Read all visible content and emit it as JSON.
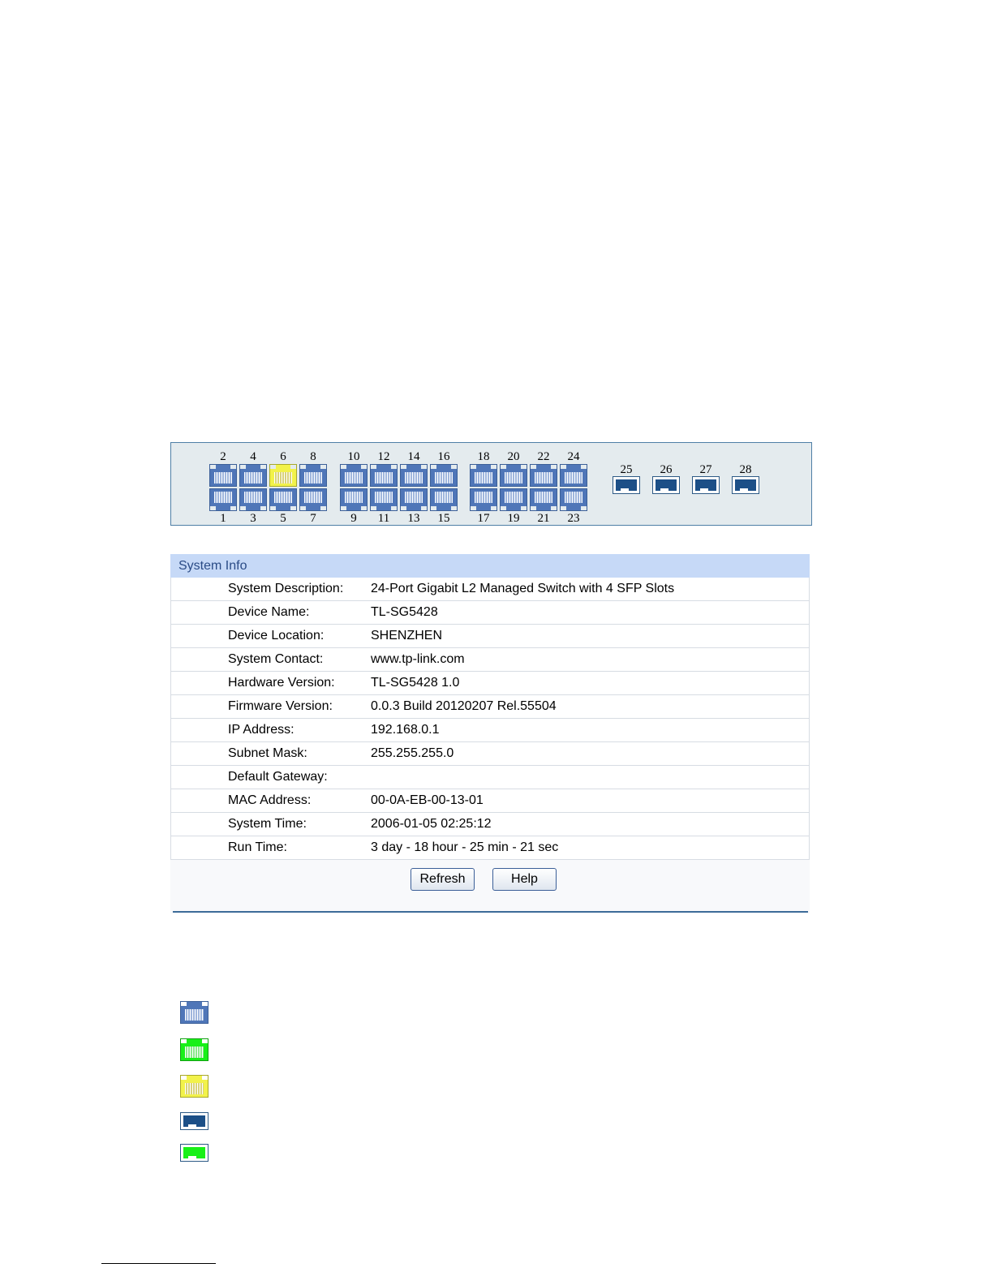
{
  "port_panel": {
    "top_labels": [
      "2",
      "4",
      "6",
      "8",
      "10",
      "12",
      "14",
      "16",
      "18",
      "20",
      "22",
      "24"
    ],
    "bottom_labels": [
      "1",
      "3",
      "5",
      "7",
      "9",
      "11",
      "13",
      "15",
      "17",
      "19",
      "21",
      "23"
    ],
    "sfp_labels": [
      "25",
      "26",
      "27",
      "28"
    ],
    "active_port": "6",
    "colors": {
      "port_blue": "#4f76b8",
      "port_yellow": "#f2f24a",
      "port_green": "#18f018",
      "sfp_blue": "#1c4f87"
    }
  },
  "system_info": {
    "header": "System Info",
    "rows": [
      {
        "label": "System Description:",
        "value": "24-Port Gigabit L2 Managed Switch with 4 SFP Slots"
      },
      {
        "label": "Device Name:",
        "value": "TL-SG5428"
      },
      {
        "label": "Device Location:",
        "value": "SHENZHEN"
      },
      {
        "label": "System Contact:",
        "value": "www.tp-link.com"
      },
      {
        "label": "Hardware Version:",
        "value": "TL-SG5428 1.0"
      },
      {
        "label": "Firmware Version:",
        "value": "0.0.3 Build 20120207 Rel.55504"
      },
      {
        "label": "IP Address:",
        "value": "192.168.0.1"
      },
      {
        "label": "Subnet Mask:",
        "value": "255.255.255.0"
      },
      {
        "label": "Default Gateway:",
        "value": ""
      },
      {
        "label": "MAC Address:",
        "value": "00-0A-EB-00-13-01"
      },
      {
        "label": "System Time:",
        "value": "2006-01-05 02:25:12"
      },
      {
        "label": "Run Time:",
        "value": "3 day - 18 hour - 25 min - 21 sec"
      }
    ],
    "buttons": {
      "refresh": "Refresh",
      "help": "Help"
    }
  },
  "legend": {
    "icons": [
      "rj45-port-blue-icon",
      "rj45-port-green-icon",
      "rj45-port-yellow-icon",
      "sfp-port-blue-icon",
      "sfp-port-green-icon"
    ]
  }
}
